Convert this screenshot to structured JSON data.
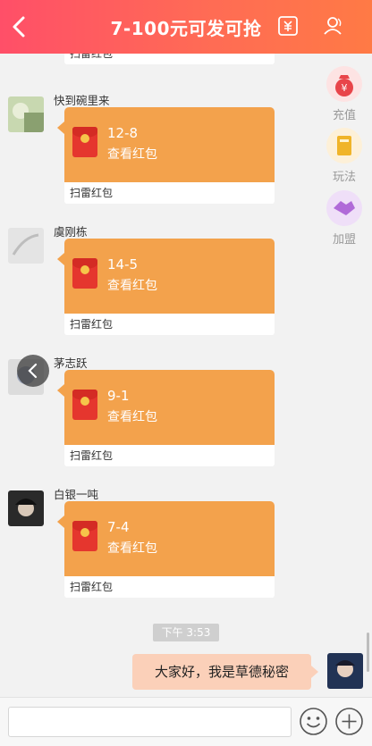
{
  "header": {
    "title": "7-100元可发可抢",
    "back_icon": "chevron-left-icon",
    "wallet_icon": "yuan-wallet-icon",
    "members_icon": "members-icon"
  },
  "side_menu": [
    {
      "label": "充值",
      "icon": "money-bag-icon",
      "color": "#fde3e3"
    },
    {
      "label": "玩法",
      "icon": "book-icon",
      "color": "#fdf0d8"
    },
    {
      "label": "加盟",
      "icon": "handshake-icon",
      "color": "#efdff8"
    }
  ],
  "messages": [
    {
      "sender": "",
      "amount": "",
      "view_text": "",
      "footer": "扫雷红包",
      "partial": true
    },
    {
      "sender": "快到碗里来",
      "amount": "12-8",
      "view_text": "查看红包",
      "footer": "扫雷红包"
    },
    {
      "sender": "虞刚栋",
      "amount": "14-5",
      "view_text": "查看红包",
      "footer": "扫雷红包"
    },
    {
      "sender": "茅志跃",
      "amount": "9-1",
      "view_text": "查看红包",
      "footer": "扫雷红包"
    },
    {
      "sender": "白银一吨",
      "amount": "7-4",
      "view_text": "查看红包",
      "footer": "扫雷红包"
    }
  ],
  "timestamp": "下午 3:53",
  "my_message": "大家好，我是草德秘密",
  "input": {
    "value": "",
    "placeholder": ""
  },
  "colors": {
    "header_start": "#ff4f68",
    "header_end": "#ff7a45",
    "red_packet": "#f3a24c",
    "my_bubble": "#fbd0b9"
  }
}
